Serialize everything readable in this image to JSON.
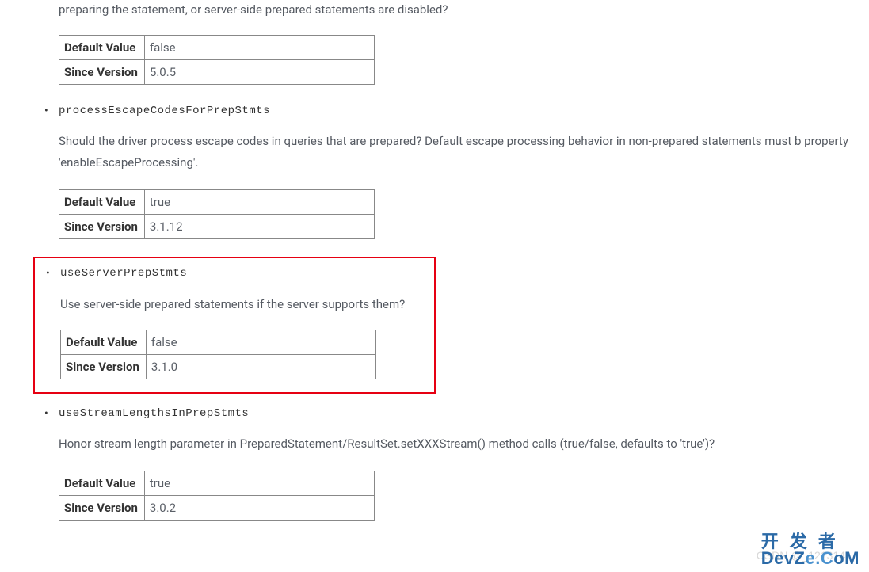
{
  "intro": "preparing the statement, or server-side prepared statements are disabled?",
  "items": [
    {
      "name": "",
      "description": "",
      "default_value_label": "Default Value",
      "default_value": "false",
      "since_label": "Since Version",
      "since_version": "5.0.5"
    },
    {
      "name": "processEscapeCodesForPrepStmts",
      "description": "Should the driver process escape codes in queries that are prepared? Default escape processing behavior in non-prepared statements must b property 'enableEscapeProcessing'.",
      "default_value_label": "Default Value",
      "default_value": "true",
      "since_label": "Since Version",
      "since_version": "3.1.12"
    },
    {
      "name": "useServerPrepStmts",
      "description": "Use server-side prepared statements if the server supports them?",
      "default_value_label": "Default Value",
      "default_value": "false",
      "since_label": "Since Version",
      "since_version": "3.1.0"
    },
    {
      "name": "useStreamLengthsInPrepStmts",
      "description": "Honor stream length parameter in PreparedStatement/ResultSet.setXXXStream() method calls (true/false, defaults to 'true')?",
      "default_value_label": "Default Value",
      "default_value": "true",
      "since_label": "Since Version",
      "since_version": "3.0.2"
    }
  ],
  "watermark": {
    "cn": "开发者",
    "en_pre": "DevZ",
    "en_mid": "e.C",
    "en_post": "oM",
    "csdn": "CSDN @_121314"
  }
}
